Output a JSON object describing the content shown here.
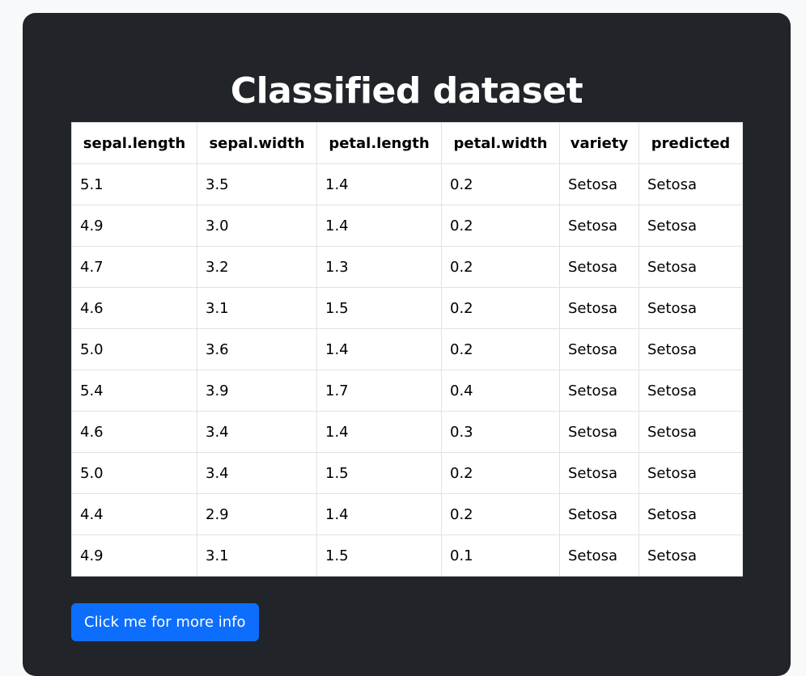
{
  "page": {
    "title": "Classified dataset"
  },
  "table": {
    "headers": [
      "sepal.length",
      "sepal.width",
      "petal.length",
      "petal.width",
      "variety",
      "predicted"
    ],
    "rows": [
      [
        "5.1",
        "3.5",
        "1.4",
        "0.2",
        "Setosa",
        "Setosa"
      ],
      [
        "4.9",
        "3.0",
        "1.4",
        "0.2",
        "Setosa",
        "Setosa"
      ],
      [
        "4.7",
        "3.2",
        "1.3",
        "0.2",
        "Setosa",
        "Setosa"
      ],
      [
        "4.6",
        "3.1",
        "1.5",
        "0.2",
        "Setosa",
        "Setosa"
      ],
      [
        "5.0",
        "3.6",
        "1.4",
        "0.2",
        "Setosa",
        "Setosa"
      ],
      [
        "5.4",
        "3.9",
        "1.7",
        "0.4",
        "Setosa",
        "Setosa"
      ],
      [
        "4.6",
        "3.4",
        "1.4",
        "0.3",
        "Setosa",
        "Setosa"
      ],
      [
        "5.0",
        "3.4",
        "1.5",
        "0.2",
        "Setosa",
        "Setosa"
      ],
      [
        "4.4",
        "2.9",
        "1.4",
        "0.2",
        "Setosa",
        "Setosa"
      ],
      [
        "4.9",
        "3.1",
        "1.5",
        "0.1",
        "Setosa",
        "Setosa"
      ]
    ]
  },
  "button": {
    "label": "Click me for more info"
  },
  "colors": {
    "card_background": "#212529",
    "button_background": "#0d6efd",
    "table_background": "#ffffff",
    "title_text": "#ffffff"
  }
}
